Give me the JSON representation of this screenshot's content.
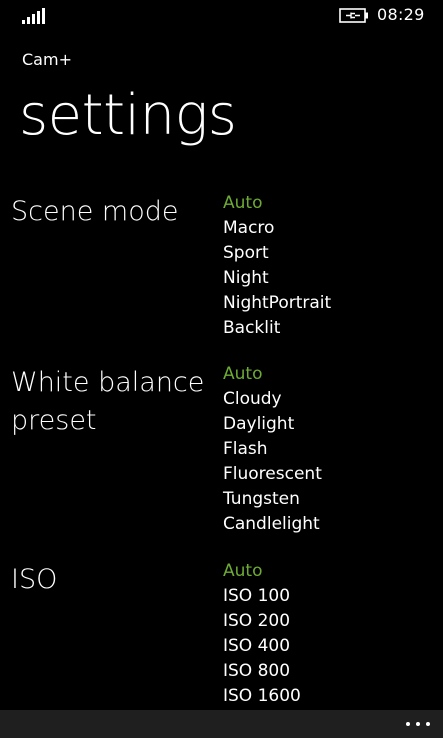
{
  "status_bar": {
    "time": "08:29",
    "signal_icon": "signal-strength-icon",
    "battery_icon": "battery-charging-icon"
  },
  "app": {
    "name": "Cam+"
  },
  "page": {
    "title": "settings"
  },
  "settings": {
    "scene_mode": {
      "label": "Scene mode",
      "selected": "Auto",
      "options": [
        "Auto",
        "Macro",
        "Sport",
        "Night",
        "NightPortrait",
        "Backlit"
      ]
    },
    "white_balance": {
      "label_line1": "White balance",
      "label_line2": "preset",
      "selected": "Auto",
      "options": [
        "Auto",
        "Cloudy",
        "Daylight",
        "Flash",
        "Fluorescent",
        "Tungsten",
        "Candlelight"
      ]
    },
    "iso": {
      "label": "ISO",
      "selected": "Auto",
      "options": [
        "Auto",
        "ISO 100",
        "ISO 200",
        "ISO 400",
        "ISO 800",
        "ISO 1600"
      ]
    }
  },
  "app_bar": {
    "more_icon": "more-ellipsis-icon"
  },
  "colors": {
    "accent": "#6eab35",
    "background": "#000000",
    "text": "#ffffff",
    "app_bar": "#1f1f1f"
  }
}
